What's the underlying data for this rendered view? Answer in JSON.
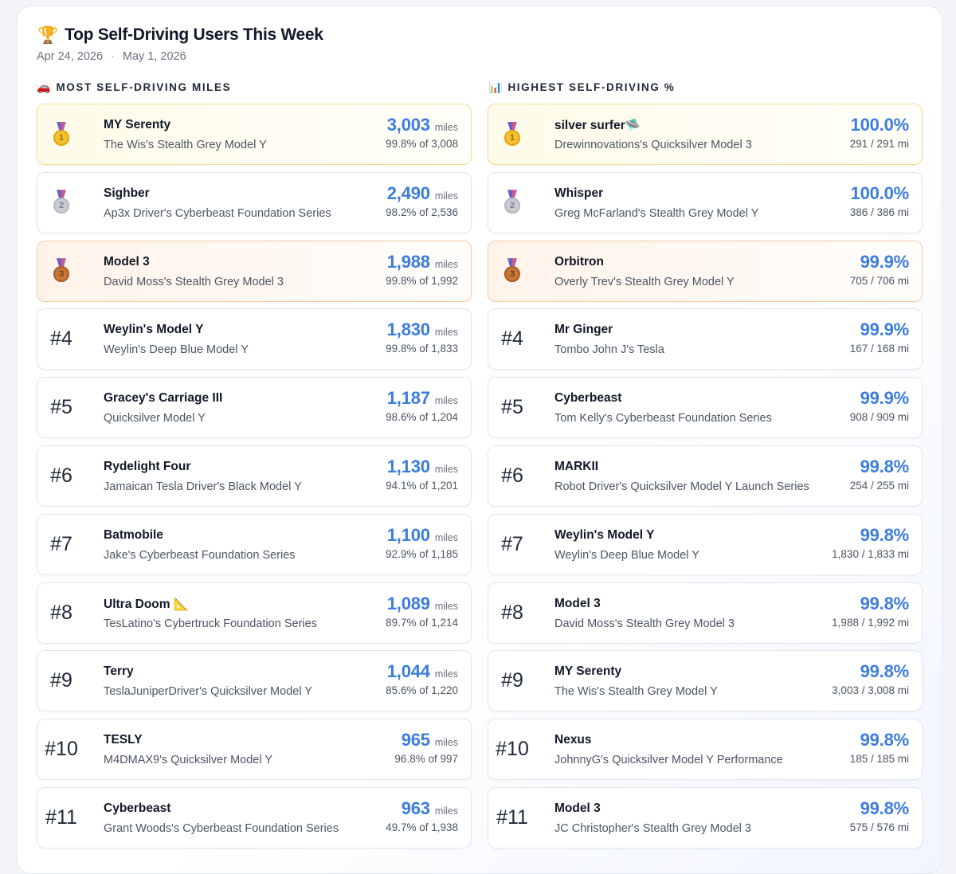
{
  "header": {
    "title_icon": "🏆",
    "title": "Top Self-Driving Users This Week",
    "date_start": "Apr 24, 2026",
    "date_sep": "·",
    "date_end": "May 1, 2026"
  },
  "colors": {
    "accent": "#3b7ddd",
    "gold_bg": "#fffbea",
    "bronze_bg": "#fff3e9"
  },
  "left": {
    "heading_icon": "🚗",
    "heading": "MOST SELF-DRIVING MILES",
    "unit_label": "miles",
    "rows": [
      {
        "medal": "gold",
        "medal_num": "1",
        "name": "MY Serenty",
        "car": "The Wis's Stealth Grey Model Y",
        "value": "3,003",
        "sub": "99.8% of 3,008"
      },
      {
        "medal": "silver",
        "medal_num": "2",
        "name": "Sighber",
        "car": "Ap3x Driver's Cyberbeast Foundation Series",
        "value": "2,490",
        "sub": "98.2% of 2,536"
      },
      {
        "medal": "bronze",
        "medal_num": "3",
        "name": "Model 3",
        "car": "David Moss's Stealth Grey Model 3",
        "value": "1,988",
        "sub": "99.8% of 1,992"
      },
      {
        "rank": "#4",
        "name": "Weylin's Model Y",
        "car": "Weylin's Deep Blue Model Y",
        "value": "1,830",
        "sub": "99.8% of 1,833"
      },
      {
        "rank": "#5",
        "name": "Gracey's Carriage III",
        "car": "Quicksilver Model Y",
        "value": "1,187",
        "sub": "98.6% of 1,204"
      },
      {
        "rank": "#6",
        "name": "Rydelight Four",
        "car": "Jamaican Tesla Driver's Black Model Y",
        "value": "1,130",
        "sub": "94.1% of 1,201"
      },
      {
        "rank": "#7",
        "name": "Batmobile",
        "car": "Jake's Cyberbeast Foundation Series",
        "value": "1,100",
        "sub": "92.9% of 1,185"
      },
      {
        "rank": "#8",
        "name": "Ultra Doom 📐",
        "car": "TesLatino's Cybertruck Foundation Series",
        "value": "1,089",
        "sub": "89.7% of 1,214"
      },
      {
        "rank": "#9",
        "name": "Terry",
        "car": "TeslaJuniperDriver's Quicksilver Model Y",
        "value": "1,044",
        "sub": "85.6% of 1,220"
      },
      {
        "rank": "#10",
        "name": "TESLY",
        "car": "M4DMAX9's Quicksilver Model Y",
        "value": "965",
        "sub": "96.8% of 997"
      },
      {
        "rank": "#11",
        "name": "Cyberbeast",
        "car": "Grant Woods's Cyberbeast Foundation Series",
        "value": "963",
        "sub": "49.7% of 1,938"
      }
    ]
  },
  "right": {
    "heading_icon": "📊",
    "heading": "HIGHEST SELF-DRIVING %",
    "rows": [
      {
        "medal": "gold",
        "medal_num": "1",
        "name": "silver surfer🛸",
        "car": "Drewinnovations's Quicksilver Model 3",
        "value": "100.0%",
        "sub": "291 / 291 mi"
      },
      {
        "medal": "silver",
        "medal_num": "2",
        "name": "Whisper",
        "car": "Greg McFarland's Stealth Grey Model Y",
        "value": "100.0%",
        "sub": "386 / 386 mi"
      },
      {
        "medal": "bronze",
        "medal_num": "3",
        "name": "Orbitron",
        "car": "Overly Trev's Stealth Grey Model Y",
        "value": "99.9%",
        "sub": "705 / 706 mi"
      },
      {
        "rank": "#4",
        "name": "Mr Ginger",
        "car": "Tombo John J's Tesla",
        "value": "99.9%",
        "sub": "167 / 168 mi"
      },
      {
        "rank": "#5",
        "name": "Cyberbeast",
        "car": "Tom Kelly's Cyberbeast Foundation Series",
        "value": "99.9%",
        "sub": "908 / 909 mi"
      },
      {
        "rank": "#6",
        "name": "MARKII",
        "car": "Robot Driver's Quicksilver Model Y Launch Series",
        "value": "99.8%",
        "sub": "254 / 255 mi"
      },
      {
        "rank": "#7",
        "name": "Weylin's Model Y",
        "car": "Weylin's Deep Blue Model Y",
        "value": "99.8%",
        "sub": "1,830 / 1,833 mi"
      },
      {
        "rank": "#8",
        "name": "Model 3",
        "car": "David Moss's Stealth Grey Model 3",
        "value": "99.8%",
        "sub": "1,988 / 1,992 mi"
      },
      {
        "rank": "#9",
        "name": "MY Serenty",
        "car": "The Wis's Stealth Grey Model Y",
        "value": "99.8%",
        "sub": "3,003 / 3,008 mi"
      },
      {
        "rank": "#10",
        "name": "Nexus",
        "car": "JohnnyG's Quicksilver Model Y Performance",
        "value": "99.8%",
        "sub": "185 / 185 mi"
      },
      {
        "rank": "#11",
        "name": "Model 3",
        "car": "JC Christopher's Stealth Grey Model 3",
        "value": "99.8%",
        "sub": "575 / 576 mi"
      }
    ]
  }
}
